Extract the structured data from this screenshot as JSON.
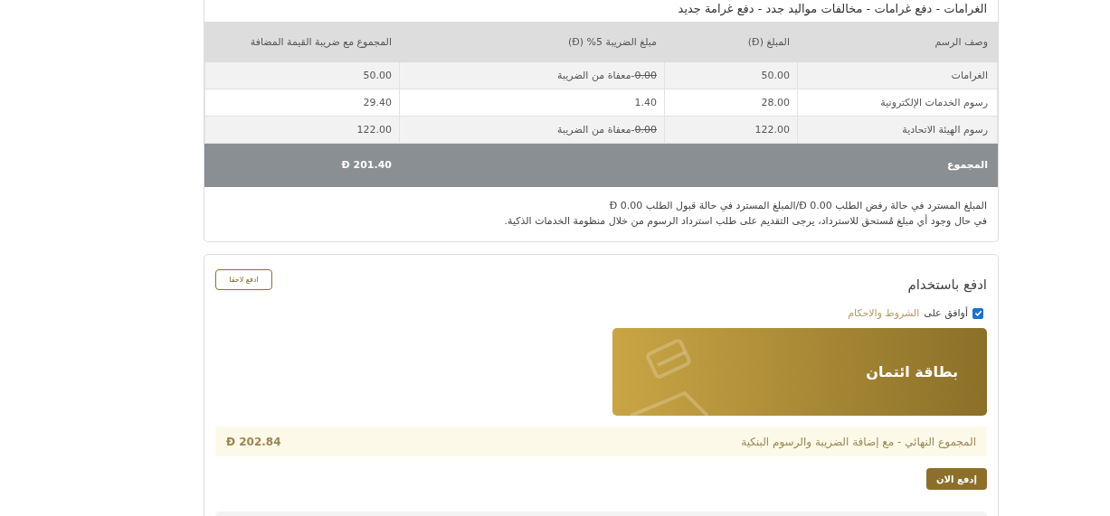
{
  "fees_card": {
    "title": "الغرامات - دفع غرامات - مخالفات مواليد جدد - دفع غرامة جديد",
    "columns": [
      "وصف الرسم",
      "المبلغ (Đ)",
      "مبلغ الضريبة 5% (Đ)",
      "المجموع مع ضريبة القيمة المضافة"
    ],
    "rows": [
      {
        "description": "الغرامات",
        "amount": "50.00",
        "tax": "0.00",
        "tax_struck": true,
        "tax_note": "-معفاة من الضريبة",
        "total": "50.00"
      },
      {
        "description": "رسوم الخدمات الإلكترونية",
        "amount": "28.00",
        "tax": "1.40",
        "tax_struck": false,
        "total": "29.40"
      },
      {
        "description": "رسوم الهيئة الاتحادية",
        "amount": "122.00",
        "tax": "0.00",
        "tax_struck": true,
        "tax_note": "-معفاة من الضريبة",
        "total": "122.00"
      }
    ],
    "total_row": {
      "label": "المجموع",
      "value": "Đ 201.40"
    },
    "notes": [
      "المبلغ المسترد في حالة رفض الطلب 0.00 Đ/المبلغ المسترد في حالة قبول الطلب 0.00 Đ",
      "في حال وجود أي مبلغ مُستحق للاسترداد، يرجى التقديم على طلب استرداد الرسوم من خلال منظومة الخدمات الذكية."
    ]
  },
  "payment_card": {
    "title": "ادفع باستخدام",
    "pay_later_button": "ادفع لاحقا",
    "terms": {
      "checked": true,
      "label": "أوافق على",
      "link": "الشروط والاحكام"
    },
    "methods": [
      {
        "label": "بطاقة ائتمان",
        "selected": true
      }
    ],
    "final_total": {
      "label": "المجموع النهائي - مع إضافة الضريبة والرسوم البنكية",
      "value": "Đ 202.84"
    },
    "pay_now_button": "إدفع الان"
  }
}
